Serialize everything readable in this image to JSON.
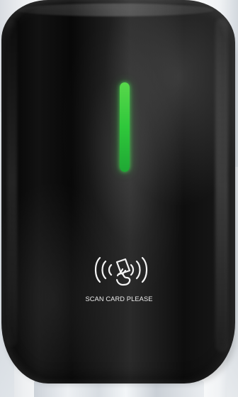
{
  "scene": {
    "device": "black RFID card reader",
    "status_light_color": "#38cc3f"
  },
  "scan_panel": {
    "icon": "contactless-card-icon",
    "label": "SCAN CARD PLEASE"
  }
}
